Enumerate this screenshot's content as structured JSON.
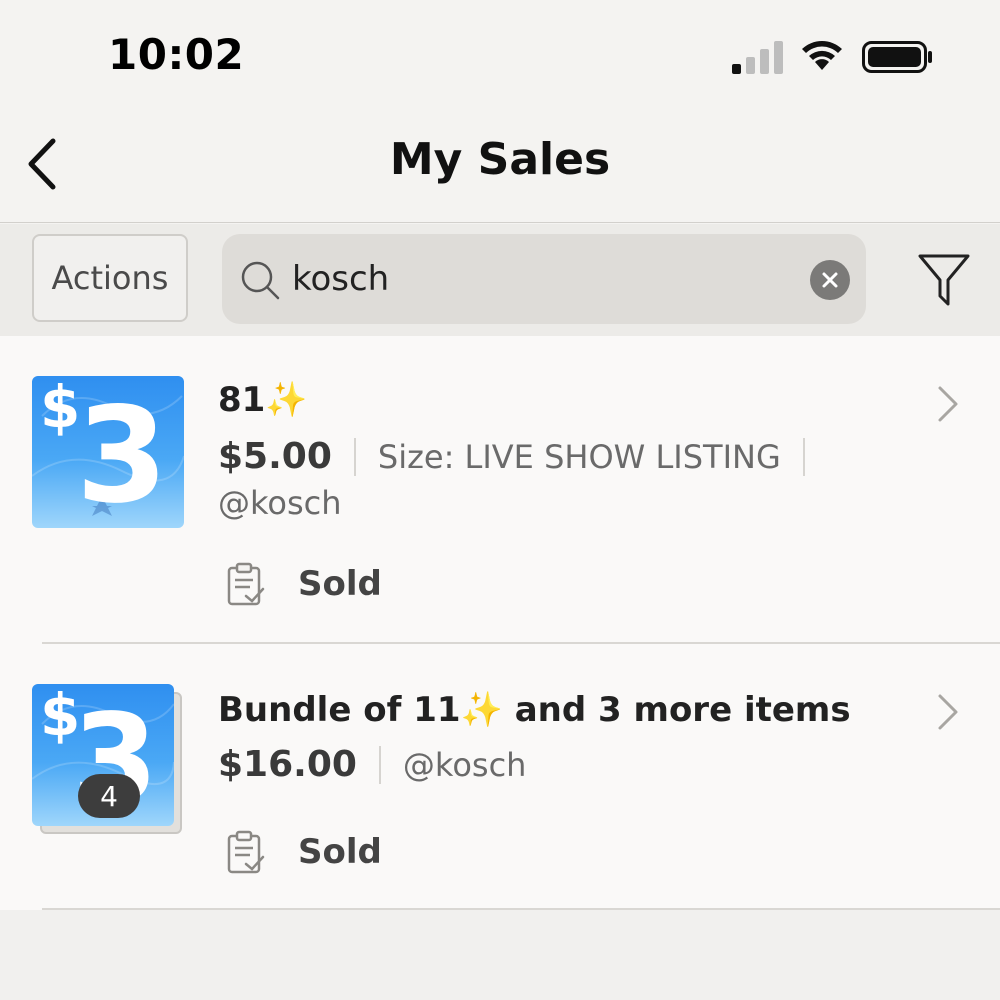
{
  "status_bar": {
    "time": "10:02",
    "icons": [
      "signal-icon",
      "wifi-icon",
      "battery-icon"
    ]
  },
  "header": {
    "title": "My Sales",
    "back_icon": "chevron-left-icon"
  },
  "toolbar": {
    "actions_label": "Actions",
    "search_value": "kosch",
    "search_icon": "search-icon",
    "clear_icon": "clear-icon",
    "filter_icon": "filter-icon"
  },
  "sales": [
    {
      "thumb_dollar": "$",
      "thumb_number": "3",
      "title": "81",
      "title_sparkle": "✨",
      "price": "$5.00",
      "size": "Size: LIVE SHOW LISTING",
      "username": "@kosch",
      "status": "Sold"
    },
    {
      "thumb_dollar": "$",
      "thumb_number": "3",
      "bundle_count": "4",
      "title_prefix": "Bundle of 11",
      "title_sparkle": "✨",
      "title_suffix": " and 3 more items",
      "price": "$16.00",
      "username": "@kosch",
      "status": "Sold"
    }
  ],
  "colors": {
    "thumb_blue": "#2f8ff0",
    "background": "#f4f3f1",
    "list_background": "#faf9f8"
  }
}
